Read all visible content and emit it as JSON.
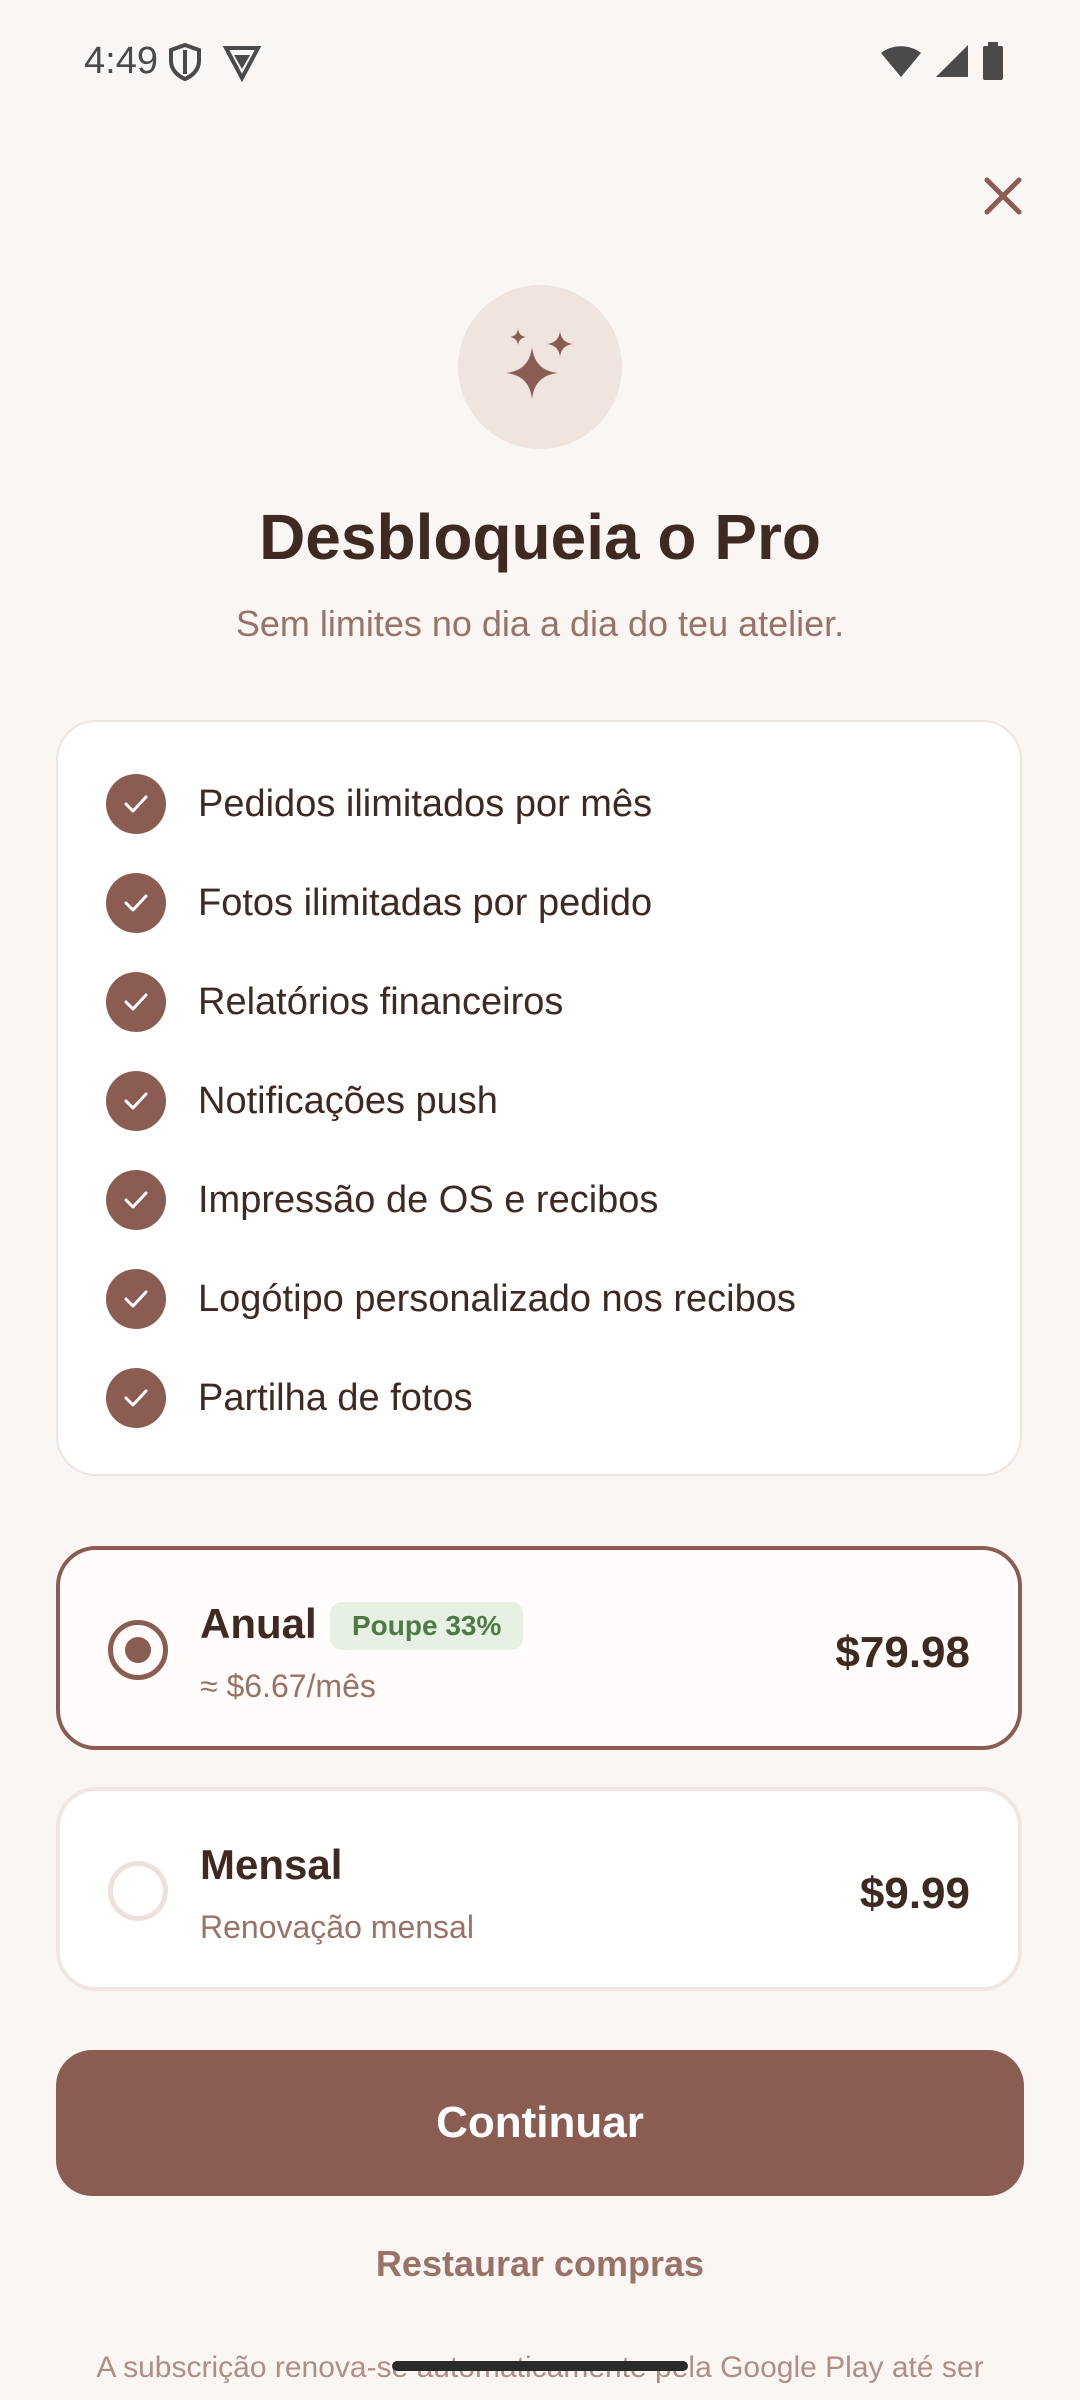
{
  "status_bar": {
    "time": "4:49",
    "left_icons": [
      "shield-icon",
      "vpn-icon"
    ],
    "right_icons": [
      "wifi-icon",
      "signal-icon",
      "battery-icon"
    ]
  },
  "hero": {
    "icon": "sparkles-icon",
    "title": "Desbloqueia o Pro",
    "subtitle": "Sem limites no dia a dia do teu atelier."
  },
  "features": [
    {
      "label": "Pedidos ilimitados por mês"
    },
    {
      "label": "Fotos ilimitadas por pedido"
    },
    {
      "label": "Relatórios financeiros"
    },
    {
      "label": "Notificações push"
    },
    {
      "label": "Impressão de OS e recibos"
    },
    {
      "label": "Logótipo personalizado nos recibos"
    },
    {
      "label": "Partilha de fotos"
    }
  ],
  "plans": [
    {
      "name": "Anual",
      "badge": "Poupe 33%",
      "sub": "≈ $6.67/mês",
      "price": "$79.98",
      "selected": true
    },
    {
      "name": "Mensal",
      "sub": "Renovação mensal",
      "price": "$9.99",
      "selected": false
    }
  ],
  "actions": {
    "continue_label": "Continuar",
    "restore_label": "Restaurar compras"
  },
  "footer": {
    "text": "A subscrição renova-se automaticamente pela Google Play até ser"
  },
  "colors": {
    "accent": "#8B5D52",
    "background": "#FAF6F3",
    "badge_bg": "#E6F0E3",
    "badge_text": "#4E7A45"
  }
}
